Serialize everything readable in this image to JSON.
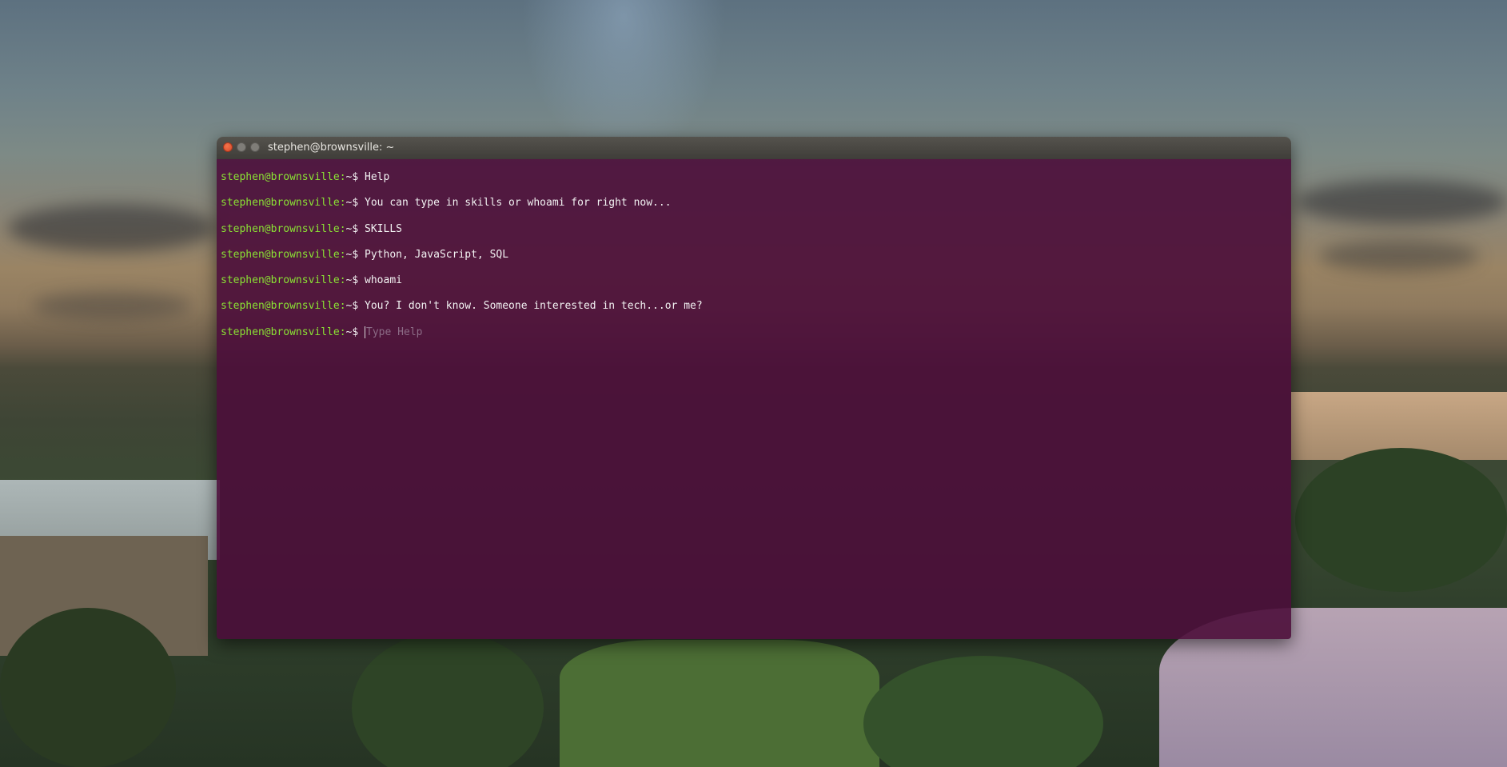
{
  "window": {
    "title": "stephen@brownsville: ~"
  },
  "prompt": {
    "user_host": "stephen@brownsville:",
    "path_symbol": "~$"
  },
  "history": [
    {
      "text": "Help"
    },
    {
      "text": "You can type in skills or whoami for right now..."
    },
    {
      "text": "SKILLS"
    },
    {
      "text": "Python, JavaScript, SQL"
    },
    {
      "text": "whoami"
    },
    {
      "text": "You? I don't know. Someone interested in tech...or me?"
    }
  ],
  "input": {
    "value": "",
    "placeholder": "Type Help"
  },
  "colors": {
    "terminal_background": "#4b0d3a",
    "prompt_user": "#8ae234",
    "close_button": "#e95d36"
  }
}
